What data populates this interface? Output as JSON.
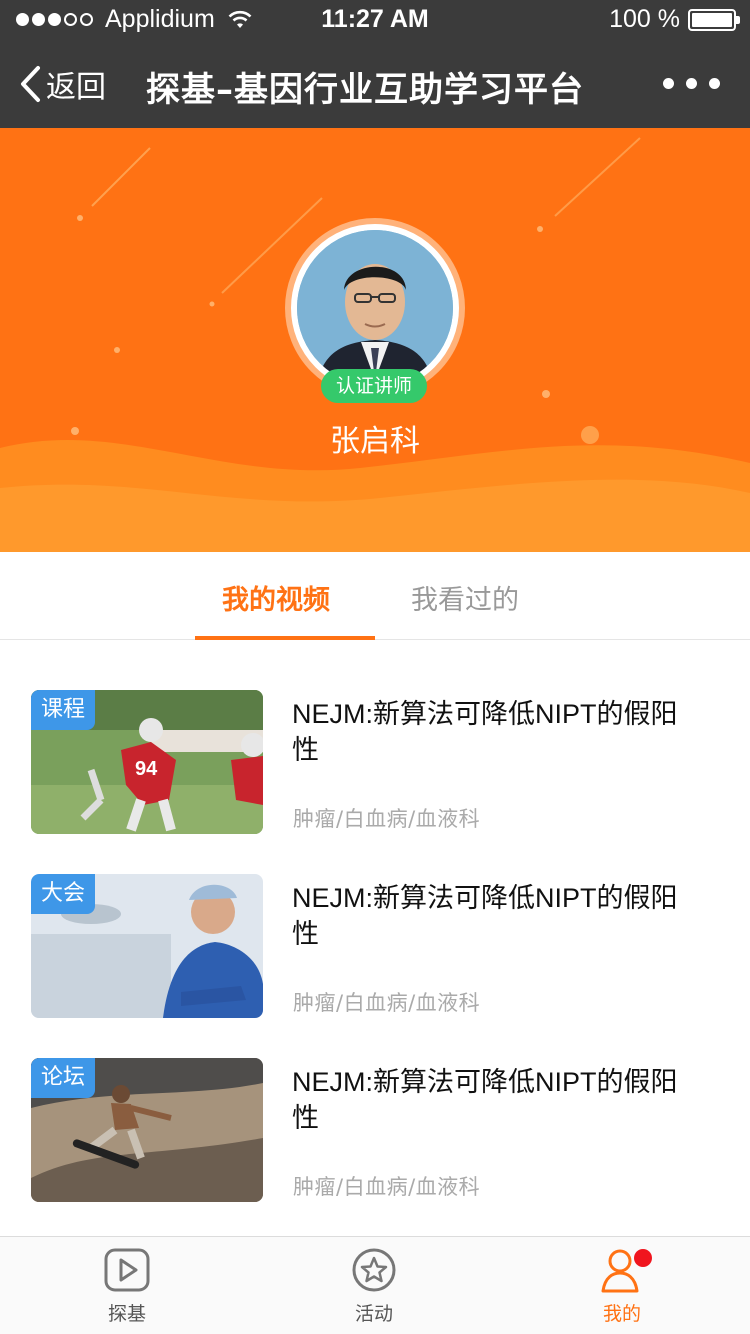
{
  "status_bar": {
    "carrier": "Applidium",
    "time": "11:27 AM",
    "battery": "100 %"
  },
  "nav": {
    "back_label": "返回",
    "title": "探基–基因行业互助学习平台"
  },
  "profile": {
    "badge": "认证讲师",
    "name": "张启科"
  },
  "tabs": [
    {
      "label": "我的视频",
      "active": true
    },
    {
      "label": "我看过的",
      "active": false
    }
  ],
  "videos": [
    {
      "tag": "课程",
      "title": "NEJM:新算法可降低NIPT的假阳性",
      "category": "肿瘤/白血病/血液科"
    },
    {
      "tag": "大会",
      "title": "NEJM:新算法可降低NIPT的假阳性",
      "category": "肿瘤/白血病/血液科"
    },
    {
      "tag": "论坛",
      "title": "NEJM:新算法可降低NIPT的假阳性",
      "category": "肿瘤/白血病/血液科"
    }
  ],
  "tabbar": [
    {
      "label": "探基",
      "icon": "play-icon"
    },
    {
      "label": "活动",
      "icon": "star-icon"
    },
    {
      "label": "我的",
      "icon": "user-icon",
      "active": true
    }
  ],
  "colors": {
    "accent": "#ff7214",
    "badge_green": "#35c96b",
    "tag_blue": "#3e97e8",
    "bar_dark": "#3b3b3b"
  }
}
